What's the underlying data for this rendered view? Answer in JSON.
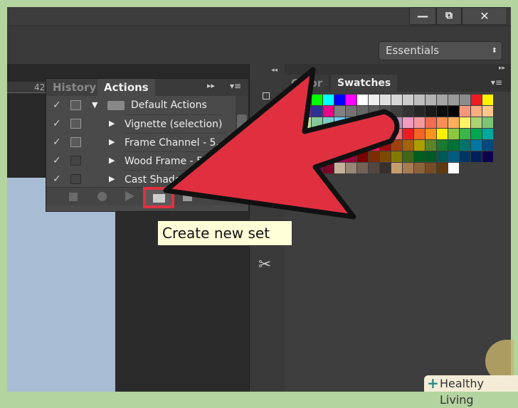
{
  "window": {
    "minimize": "—",
    "restore": "⧉",
    "close": "✕"
  },
  "workspace": {
    "value": "Essentials",
    "arrow": "⬍"
  },
  "ruler": {
    "mark": "42"
  },
  "actions_panel": {
    "tabs": [
      "History",
      "Actions"
    ],
    "expand": "▸▸",
    "menu": "▾≡",
    "rows": [
      {
        "label": "Default Actions",
        "checked": true,
        "dialog": true,
        "expanded": true,
        "folder": true
      },
      {
        "label": "Vignette (selection)",
        "checked": true,
        "dialog": true
      },
      {
        "label": "Frame Channel - 5...",
        "checked": true,
        "dialog": true
      },
      {
        "label": "Wood Frame - 5...",
        "checked": true,
        "dialog": false
      },
      {
        "label": "Cast Shadow",
        "checked": true,
        "dialog": false
      }
    ],
    "buttons": [
      "stop",
      "record",
      "play",
      "create-new-set",
      "create-new-action",
      "delete"
    ]
  },
  "right_panel": {
    "tabs": [
      "Color",
      "Swatches"
    ],
    "collapse": "◂◂",
    "expand": "▸▸",
    "menu": "▾≡"
  },
  "tooltip": "Create new set",
  "watermark": "Healthy Living",
  "colors": {
    "arrow": "#e03040",
    "highlight": "#e03040"
  },
  "swatches": [
    [
      "#ff0000",
      "#ffff00",
      "#00ff00",
      "#00ffff",
      "#0000ff",
      "#ff00ff",
      "#ffffff",
      "#eeeeee",
      "#e0e0e0",
      "#d6d6d6",
      "#cccccc",
      "#c0c0c0",
      "#b3b3b3",
      "#a6a6a6",
      "#999999",
      "#8c8c8c",
      "#ed1c24",
      "#fff200"
    ],
    [
      "#2e3192",
      "#662d91",
      "#2e3192",
      "#ec008c",
      "#808080",
      "#737373",
      "#666666",
      "#595959",
      "#4d4d4d",
      "#404040",
      "#333333",
      "#262626",
      "#1a1a1a",
      "#0d0d0d",
      "#000000",
      "#f7977a",
      "#f9ad81",
      "#fdc68a"
    ],
    [
      "#fff799",
      "#c4df9b",
      "#82ca9c",
      "#7accc8",
      "#6dcff6",
      "#7da7d9",
      "#8393ca",
      "#8781bd",
      "#a187be",
      "#bc8dbf",
      "#f49ac1",
      "#f5989d",
      "#f26c4f",
      "#f68e55",
      "#fbaf5c",
      "#fff467",
      "#acd372",
      "#7cc576"
    ],
    [
      "#3bb878",
      "#1abbb4",
      "#00bff3",
      "#438ccb",
      "#5574b9",
      "#605ca8",
      "#855fa8",
      "#a763a8",
      "#f06ea9",
      "#f26d7d",
      "#ed1c24",
      "#f26522",
      "#f7941d",
      "#fff200",
      "#8dc73f",
      "#39b54a",
      "#00a651",
      "#00a99d"
    ],
    [
      "#00aeef",
      "#0072bc",
      "#0054a6",
      "#2e3192",
      "#662d91",
      "#92278f",
      "#ec008c",
      "#ed145b",
      "#9e0b0f",
      "#a0410d",
      "#a36209",
      "#aba000",
      "#598527",
      "#1a7b30",
      "#007236",
      "#00746b",
      "#0076a3",
      "#004a80"
    ],
    [
      "#003471",
      "#1b1464",
      "#440e62",
      "#630460",
      "#9e005d",
      "#9e0039",
      "#790000",
      "#7b2e00",
      "#7d4900",
      "#827b00",
      "#406618",
      "#005e20",
      "#005826",
      "#005952",
      "#005b7f",
      "#003663",
      "#002157",
      "#0d004c"
    ],
    [
      "#32004b",
      "#4b0049",
      "#7b0046",
      "#7a0026",
      "#c7b299",
      "#998675",
      "#736357",
      "#534741",
      "#37302d",
      "#c69c6d",
      "#a67c52",
      "#8c6239",
      "#754c24",
      "#603913",
      "#ffffff"
    ]
  ]
}
